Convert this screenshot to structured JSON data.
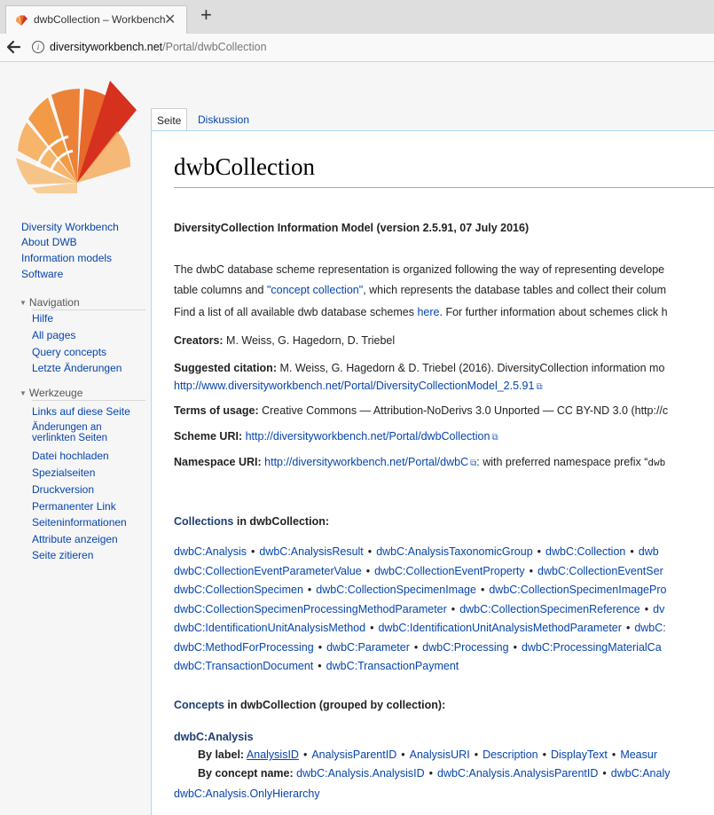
{
  "browser": {
    "tab_title": "dwbCollection – Workbench",
    "tab_close": "✕",
    "new_tab": "+",
    "url_host": "diversityworkbench.net",
    "url_path": "/Portal/dwbCollection",
    "back_icon": "arrow-left-icon",
    "info_glyph": "i"
  },
  "sidebar": {
    "top_links": [
      "Diversity Workbench",
      "About DWB",
      "Information models",
      "Software"
    ],
    "navigation": {
      "heading": "Navigation",
      "items": [
        "Hilfe",
        "All pages",
        "Query concepts",
        "Letzte Änderungen"
      ]
    },
    "werkzeuge": {
      "heading": "Werkzeuge",
      "items": [
        "Links auf diese Seite",
        "Änderungen an",
        "verlinkten Seiten",
        "Datei hochladen",
        "Spezialseiten",
        "Druckversion",
        "Permanenter Link",
        "Seiteninformationen",
        "Attribute anzeigen",
        "Seite zitieren"
      ]
    }
  },
  "page_tabs": {
    "active": "Seite",
    "other": "Diskussion"
  },
  "content": {
    "title": "dwbCollection",
    "model_heading": "DiversityCollection Information Model (version 2.5.91, 07 July 2016)",
    "intro1_a": "The dwbC database scheme representation is organized following the way of representing develope",
    "intro2_a": "table columns and ",
    "intro2_link": "\"concept collection\"",
    "intro2_b": ", which represents the database tables and collect their colum",
    "find_a": "Find a list of all available dwb database schemes ",
    "find_link": "here",
    "find_b": ". For further information about schemes click h",
    "creators_label": "Creators:",
    "creators_value": " M. Weiss, G. Hagedorn, D. Triebel",
    "citation_label": "Suggested citation:",
    "citation_value": " M. Weiss, G. Hagedorn & D. Triebel (2016). DiversityCollection information mo",
    "citation_url": "http://www.diversityworkbench.net/Portal/DiversityCollectionModel_2.5.91",
    "terms_label": "Terms of usage:",
    "terms_value": " Creative Commons — Attribution-NoDerivs 3.0 Unported — CC BY-ND 3.0 (http://c",
    "scheme_label": "Scheme URI:",
    "scheme_url": "http://diversityworkbench.net/Portal/dwbCollection",
    "ns_label": "Namespace URI:",
    "ns_url": "http://diversityworkbench.net/Portal/dwbC",
    "ns_rest": ": with preferred namespace prefix “",
    "ns_prefix": "dwb",
    "collections_heading_a": "Collections",
    "collections_heading_b": " in dwbCollection:",
    "collection_rows": [
      [
        "dwbC:Analysis",
        "dwbC:AnalysisResult",
        "dwbC:AnalysisTaxonomicGroup",
        "dwbC:Collection",
        "dwb"
      ],
      [
        "dwbC:CollectionEventParameterValue",
        "dwbC:CollectionEventProperty",
        "dwbC:CollectionEventSer"
      ],
      [
        "dwbC:CollectionSpecimen",
        "dwbC:CollectionSpecimenImage",
        "dwbC:CollectionSpecimenImagePro"
      ],
      [
        "dwbC:CollectionSpecimenProcessingMethodParameter",
        "dwbC:CollectionSpecimenReference",
        "dv"
      ],
      [
        "dwbC:IdentificationUnitAnalysisMethod",
        "dwbC:IdentificationUnitAnalysisMethodParameter",
        "dwbC:"
      ],
      [
        "dwbC:MethodForProcessing",
        "dwbC:Parameter",
        "dwbC:Processing",
        "dwbC:ProcessingMaterialCa"
      ],
      [
        "dwbC:TransactionDocument",
        "dwbC:TransactionPayment"
      ]
    ],
    "concepts_heading_a": "Concepts",
    "concepts_heading_b": " in dwbCollection (grouped by collection):",
    "analysis_heading": "dwbC:Analysis",
    "by_label": "By label:",
    "label_items": [
      "AnalysisID",
      "AnalysisParentID",
      "AnalysisURI",
      "Description",
      "DisplayText",
      "Measur"
    ],
    "by_concept": "By concept name:",
    "concept_items": [
      "dwbC:Analysis.AnalysisID",
      "dwbC:Analysis.AnalysisParentID",
      "dwbC:Analy"
    ],
    "concept_last": "dwbC:Analysis.OnlyHierarchy",
    "separator": "•",
    "ext_icon": "⧉"
  },
  "colors": {
    "link": "#0645ad",
    "heading_navy": "#1f3f73",
    "logo_red": "#d6301f",
    "logo_orange": "#f29a45"
  }
}
